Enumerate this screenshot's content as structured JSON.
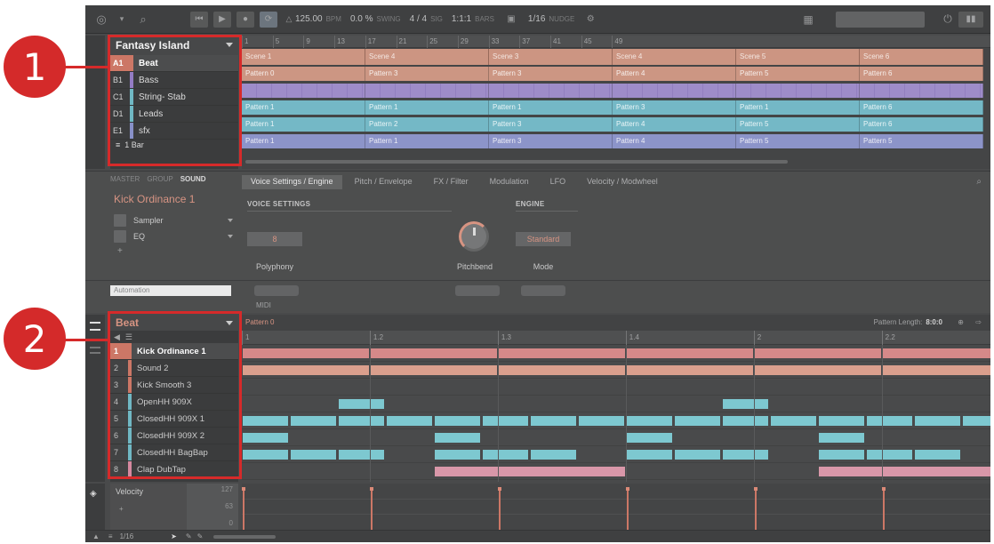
{
  "toolbar": {
    "tempo": "125.00",
    "tempo_unit": "BPM",
    "swing": "0.0 %",
    "swing_label": "SWING",
    "signature": "4 / 4",
    "signature_label": "SIG",
    "position": "1:1:1",
    "bars_label": "BARS",
    "grid": "1/16",
    "grid_label": "NUDGE"
  },
  "arranger": {
    "project_title": "Fantasy Island",
    "groups": [
      {
        "id": "A1",
        "name": "Beat",
        "color": "#e0664e"
      },
      {
        "id": "B1",
        "name": "Bass",
        "color": "#8f6dd6"
      },
      {
        "id": "C1",
        "name": "String- Stab",
        "color": "#4fb7c9"
      },
      {
        "id": "D1",
        "name": "Leads",
        "color": "#4fb7c9"
      },
      {
        "id": "E1",
        "name": "sfx",
        "color": "#7a86d8"
      }
    ],
    "footer": "1 Bar",
    "ruler_ticks": [
      "1",
      "5",
      "9",
      "13",
      "17",
      "21",
      "25",
      "29",
      "33",
      "37",
      "41",
      "45",
      "49"
    ],
    "scenes": [
      "Scene 1",
      "Scene 4",
      "Scene 3",
      "Scene 4",
      "Scene 5",
      "Scene 6"
    ],
    "rows": [
      {
        "color": "#d88a6e",
        "cells": [
          "Pattern 0",
          "Pattern 3",
          "Pattern 3",
          "Pattern 4",
          "Pattern 5",
          "Pattern 6"
        ]
      },
      {
        "color": "#9a80d8",
        "cells": [
          "",
          "",
          "",
          "",
          "",
          ""
        ]
      },
      {
        "color": "#55b8cc",
        "cells": [
          "Pattern 1",
          "Pattern 1",
          "Pattern 1",
          "Pattern 3",
          "Pattern 1",
          "Pattern 6"
        ]
      },
      {
        "color": "#55b8cc",
        "cells": [
          "Pattern 1",
          "Pattern 2",
          "Pattern 3",
          "Pattern 4",
          "Pattern 5",
          "Pattern 6"
        ]
      },
      {
        "color": "#7f8ad8",
        "cells": [
          "Pattern 1",
          "Pattern 1",
          "Pattern 3",
          "Pattern 4",
          "Pattern 5",
          "Pattern 5"
        ]
      }
    ]
  },
  "control": {
    "tabs": [
      "MASTER",
      "GROUP",
      "SOUND"
    ],
    "sound_name": "Kick Ordinance 1",
    "plugins": [
      "Sampler",
      "EQ"
    ],
    "param_tabs": [
      "Voice Settings / Engine",
      "Pitch / Envelope",
      "FX / Filter",
      "Modulation",
      "LFO",
      "Velocity / Modwheel"
    ],
    "voice_settings_label": "VOICE SETTINGS",
    "engine_label": "ENGINE",
    "polyphony_value": "8",
    "polyphony_label": "Polyphony",
    "pitchbend_label": "Pitchbend",
    "mode_value": "Standard",
    "mode_label": "Mode",
    "automation_label": "Automation",
    "midi_label": "MIDI"
  },
  "pattern": {
    "group_name": "Beat",
    "pattern_name": "Pattern 0",
    "pattern_length_label": "Pattern Length:",
    "pattern_length": "8:0:0",
    "ruler_ticks": [
      "1",
      "1.2",
      "1.3",
      "1.4",
      "2",
      "2.2"
    ],
    "sounds": [
      {
        "num": "1",
        "name": "Kick Ordinance 1",
        "color": "#e0664e"
      },
      {
        "num": "2",
        "name": "Sound 2",
        "color": "#e0664e"
      },
      {
        "num": "3",
        "name": "Kick Smooth 3",
        "color": "#e0664e"
      },
      {
        "num": "4",
        "name": "OpenHH 909X",
        "color": "#4fb7c9"
      },
      {
        "num": "5",
        "name": "ClosedHH 909X 1",
        "color": "#4fb7c9"
      },
      {
        "num": "6",
        "name": "ClosedHH 909X 2",
        "color": "#4fb7c9"
      },
      {
        "num": "7",
        "name": "ClosedHH BagBap",
        "color": "#4fb7c9"
      },
      {
        "num": "8",
        "name": "Clap DubTap",
        "color": "#e87a9a"
      }
    ]
  },
  "modulation": {
    "label": "Velocity",
    "max": "127",
    "mid": "63",
    "min": "0"
  },
  "footer": {
    "grid": "1/16"
  },
  "callouts": [
    "1",
    "2"
  ]
}
